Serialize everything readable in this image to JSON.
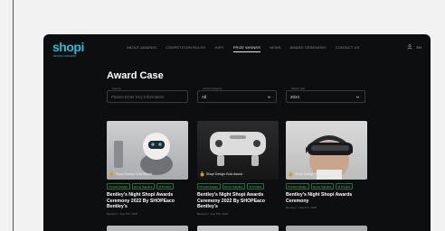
{
  "brand": {
    "logo_text": "shopi",
    "logo_sub": "DESIGN AWARDS"
  },
  "nav": {
    "items": [
      {
        "label": "ABOUT AWARDS"
      },
      {
        "label": "COMPETITION RULES"
      },
      {
        "label": "JURY"
      },
      {
        "label": "PRIZE WINNER"
      },
      {
        "label": "NEWS"
      },
      {
        "label": "AWARD CEREMONY"
      },
      {
        "label": "CONTACT US"
      }
    ],
    "active_index": 3,
    "lang": "EN"
  },
  "page": {
    "title": "Award Case"
  },
  "filters": {
    "search": {
      "label": "Search",
      "placeholder": "Please Enter Key Information"
    },
    "category": {
      "label": "Award Category",
      "value": "All"
    },
    "year": {
      "label": "Select Year",
      "value": "2024"
    }
  },
  "cards": [
    {
      "badge": "Shopi Design Gold Award",
      "tags": [
        "Product Design",
        "Home Supplies",
        "AI Product"
      ],
      "title": "Bentley's Night Shopi Awards Ceremony 2022 By SHOPEaco Bentley's",
      "meta": "Bentley's / July 6Th, 2025"
    },
    {
      "badge": "Shopi Design Gold Award",
      "tags": [
        "Product Design",
        "Home Supplies",
        "AI Product"
      ],
      "title": "Bentley's Night Shopi Awards Ceremony 2022 By SHOPEaco Bentley's",
      "meta": "Bentley's / July 6Th, 2025"
    },
    {
      "badge": "Shopi Design Gold Award",
      "tags": [
        "Product Design",
        "Home Supplies",
        "AI Product"
      ],
      "title": "Bentley's Night Shopi Awards Ceremony",
      "meta": "Bentley's / July 6Th, 2025"
    }
  ],
  "colors": {
    "accent": "#2fb9d3",
    "background": "#0d0e0f",
    "tag": "#5fd07a",
    "gold": "#d4a017"
  }
}
